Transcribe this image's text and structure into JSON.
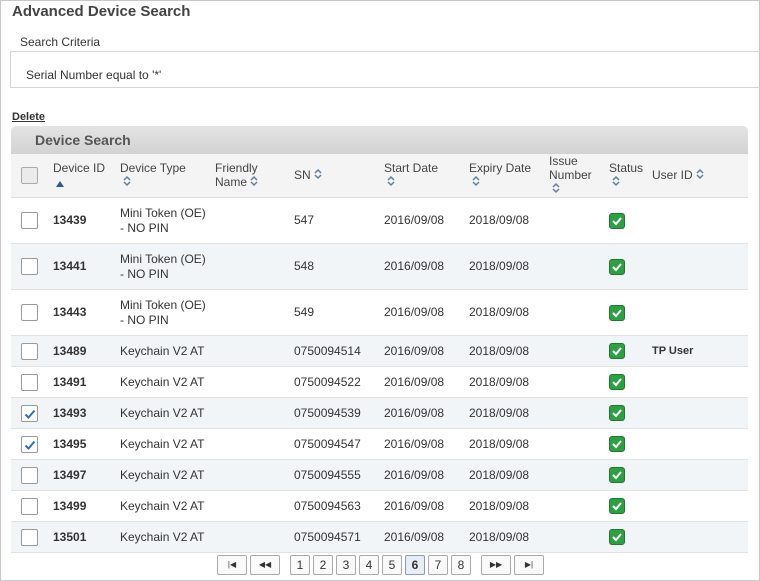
{
  "page": {
    "title": "Advanced Device Search"
  },
  "criteria": {
    "legend": "Search Criteria",
    "text": "Serial Number equal to '*'"
  },
  "actions": {
    "delete_label": "Delete"
  },
  "grid": {
    "title": "Device Search",
    "columns": {
      "device_id": "Device ID",
      "device_type": "Device Type",
      "friendly_name": "Friendly Name",
      "sn": "SN",
      "start_date": "Start Date",
      "expiry_date": "Expiry Date",
      "issue_number": "Issue Number",
      "status": "Status",
      "user_id": "User ID"
    },
    "rows": [
      {
        "checked": false,
        "device_id": "13439",
        "device_type": "Mini Token (OE) - NO PIN",
        "friendly_name": "",
        "sn": "547",
        "start_date": "2016/09/08",
        "expiry_date": "2018/09/08",
        "issue_number": "",
        "status": "active",
        "user_id": ""
      },
      {
        "checked": false,
        "device_id": "13441",
        "device_type": "Mini Token (OE) - NO PIN",
        "friendly_name": "",
        "sn": "548",
        "start_date": "2016/09/08",
        "expiry_date": "2018/09/08",
        "issue_number": "",
        "status": "active",
        "user_id": ""
      },
      {
        "checked": false,
        "device_id": "13443",
        "device_type": "Mini Token (OE) - NO PIN",
        "friendly_name": "",
        "sn": "549",
        "start_date": "2016/09/08",
        "expiry_date": "2018/09/08",
        "issue_number": "",
        "status": "active",
        "user_id": ""
      },
      {
        "checked": false,
        "device_id": "13489",
        "device_type": "Keychain V2 AT",
        "friendly_name": "",
        "sn": "0750094514",
        "start_date": "2016/09/08",
        "expiry_date": "2018/09/08",
        "issue_number": "",
        "status": "active",
        "user_id": "TP User"
      },
      {
        "checked": false,
        "device_id": "13491",
        "device_type": "Keychain V2 AT",
        "friendly_name": "",
        "sn": "0750094522",
        "start_date": "2016/09/08",
        "expiry_date": "2018/09/08",
        "issue_number": "",
        "status": "active",
        "user_id": ""
      },
      {
        "checked": true,
        "device_id": "13493",
        "device_type": "Keychain V2 AT",
        "friendly_name": "",
        "sn": "0750094539",
        "start_date": "2016/09/08",
        "expiry_date": "2018/09/08",
        "issue_number": "",
        "status": "active",
        "user_id": ""
      },
      {
        "checked": true,
        "device_id": "13495",
        "device_type": "Keychain V2 AT",
        "friendly_name": "",
        "sn": "0750094547",
        "start_date": "2016/09/08",
        "expiry_date": "2018/09/08",
        "issue_number": "",
        "status": "active",
        "user_id": ""
      },
      {
        "checked": false,
        "device_id": "13497",
        "device_type": "Keychain V2 AT",
        "friendly_name": "",
        "sn": "0750094555",
        "start_date": "2016/09/08",
        "expiry_date": "2018/09/08",
        "issue_number": "",
        "status": "active",
        "user_id": ""
      },
      {
        "checked": false,
        "device_id": "13499",
        "device_type": "Keychain V2 AT",
        "friendly_name": "",
        "sn": "0750094563",
        "start_date": "2016/09/08",
        "expiry_date": "2018/09/08",
        "issue_number": "",
        "status": "active",
        "user_id": ""
      },
      {
        "checked": false,
        "device_id": "13501",
        "device_type": "Keychain V2 AT",
        "friendly_name": "",
        "sn": "0750094571",
        "start_date": "2016/09/08",
        "expiry_date": "2018/09/08",
        "issue_number": "",
        "status": "active",
        "user_id": ""
      }
    ]
  },
  "pager": {
    "first_icon": "first-page-icon",
    "prev_icon": "previous-page-icon",
    "next_icon": "next-page-icon",
    "last_icon": "last-page-icon",
    "pages": [
      "1",
      "2",
      "3",
      "4",
      "5",
      "6",
      "7",
      "8"
    ],
    "current": "6"
  },
  "colors": {
    "status_ok": "#2ea043",
    "header_bg": "#d8d8d8",
    "alt_row": "#f1f5f8",
    "check_mark": "#2f6fb3"
  }
}
